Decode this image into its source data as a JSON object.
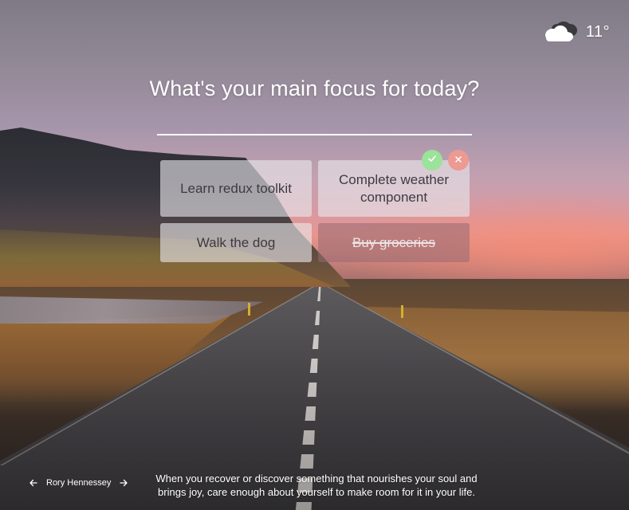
{
  "weather": {
    "temperature": "11°",
    "icon": "cloud-icon"
  },
  "focus": {
    "question": "What's your main focus for today?",
    "input_value": ""
  },
  "tasks": [
    {
      "label": "Learn redux toolkit",
      "completed": false
    },
    {
      "label": "Complete weather component",
      "completed": false
    },
    {
      "label": "Walk the dog",
      "completed": false
    },
    {
      "label": "Buy groceries",
      "completed": true
    }
  ],
  "task_actions": {
    "complete_icon": "check-icon",
    "delete_icon": "close-icon"
  },
  "photo_credit": {
    "author": "Rory Hennessey",
    "prev_icon": "arrow-left-icon",
    "next_icon": "arrow-right-icon"
  },
  "quote": {
    "text": "When you recover or discover something that nourishes your soul and brings joy, care enough about yourself to make room for it in your life."
  },
  "colors": {
    "check": "#9be29a",
    "delete": "#ec9a92",
    "card": "#e8e6ec"
  }
}
